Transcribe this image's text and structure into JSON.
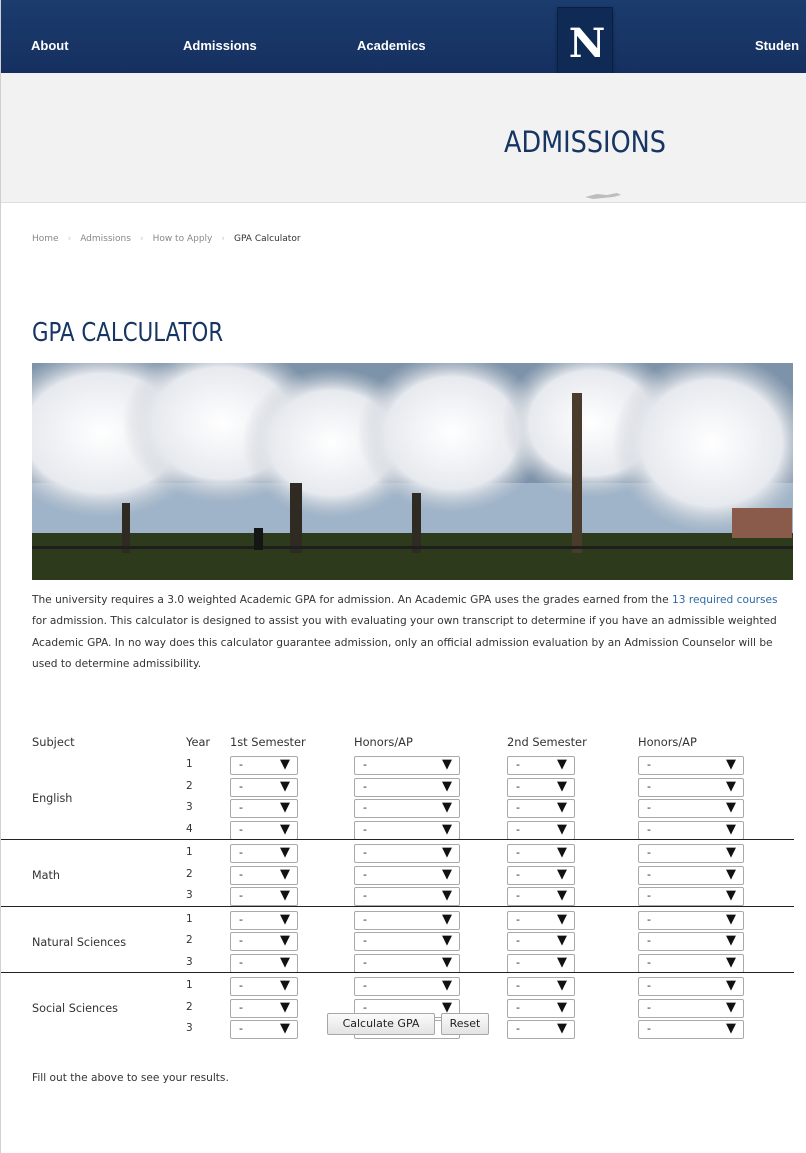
{
  "nav": {
    "items": [
      "About",
      "Admissions",
      "Academics",
      "Studen"
    ],
    "logo": "N"
  },
  "banner": {
    "title": "ADMISSIONS"
  },
  "breadcrumb": [
    "Home",
    "Admissions",
    "How to Apply",
    "GPA Calculator"
  ],
  "page_title": "GPA CALCULATOR",
  "intro": {
    "before_link": "The university requires a 3.0 weighted Academic GPA for admission. An Academic GPA uses the grades earned from the ",
    "link": "13 required courses",
    "after_link": " for admission. This calculator is designed to assist you with evaluating your own transcript to determine if you have an admissible weighted Academic GPA. In no way does this calculator guarantee admission, only an official admission evaluation by an Admission Counselor will be used to determine admissibility."
  },
  "table": {
    "headers": {
      "subject": "Subject",
      "year": "Year",
      "sem1": "1st Semester",
      "hon1": "Honors/AP",
      "sem2": "2nd Semester",
      "hon2": "Honors/AP"
    },
    "select_value": "-",
    "subjects": [
      {
        "name": "English",
        "years": [
          "1",
          "2",
          "3",
          "4"
        ]
      },
      {
        "name": "Math",
        "years": [
          "1",
          "2",
          "3"
        ]
      },
      {
        "name": "Natural Sciences",
        "years": [
          "1",
          "2",
          "3"
        ]
      },
      {
        "name": "Social Sciences",
        "years": [
          "1",
          "2",
          "3"
        ]
      }
    ]
  },
  "buttons": {
    "calculate": "Calculate GPA",
    "reset": "Reset"
  },
  "result_text": "Fill out the above to see your results."
}
